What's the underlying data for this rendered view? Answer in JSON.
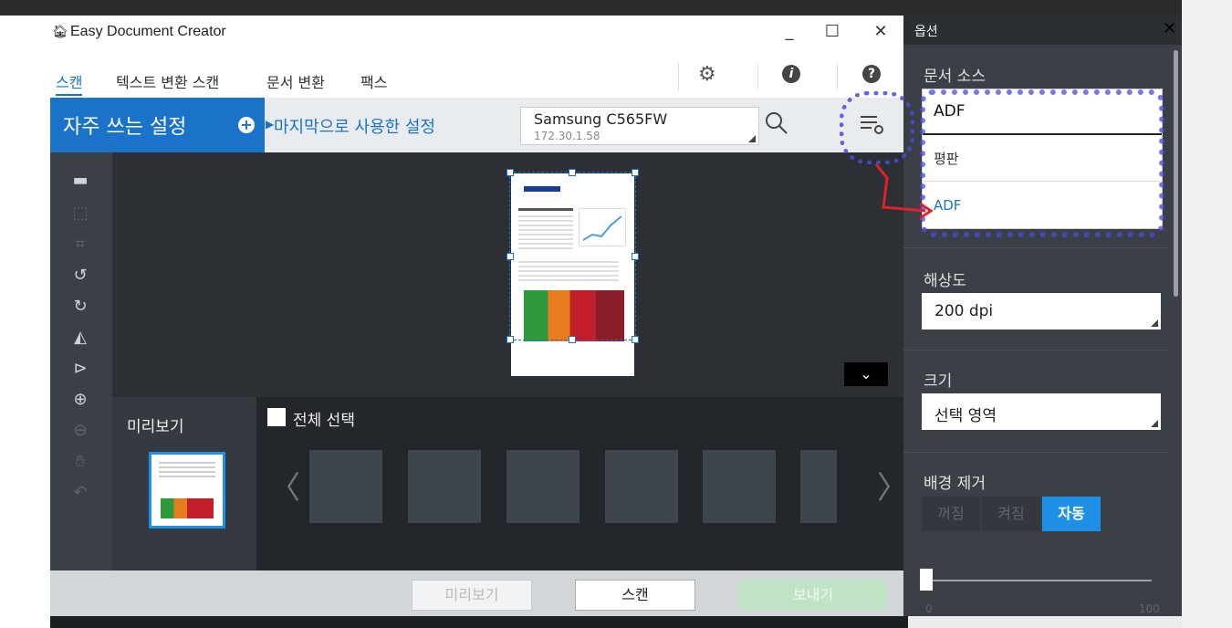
{
  "app": {
    "title": "Easy Document Creator",
    "window_buttons": {
      "minimize": "_",
      "maximize": "☐",
      "close": "✕"
    }
  },
  "menu": {
    "items": [
      "스캔",
      "텍스트 변환 스캔",
      "문서 변환",
      "팩스"
    ]
  },
  "presets": {
    "title": "자주 쓰는 설정",
    "plus": "+",
    "last_used": "마지막으로 사용한 설정"
  },
  "device": {
    "name": "Samsung C565FW",
    "ip": "172.30.1.58"
  },
  "preview": {
    "label": "미리보기",
    "select_all": "전체 선택",
    "nav_prev": "〈",
    "nav_next": "〉",
    "collapse": "⌄"
  },
  "bottom": {
    "preview": "미리보기",
    "scan": "스캔",
    "send": "보내기"
  },
  "options": {
    "title": "옵션",
    "close": "✕",
    "source": {
      "label": "문서 소스",
      "value": "ADF",
      "dropdown": [
        "평판",
        "ADF"
      ]
    },
    "resolution": {
      "label": "해상도",
      "value": "200 dpi"
    },
    "size": {
      "label": "크기",
      "value": "선택 영역"
    },
    "background_removal": {
      "label": "배경 제거",
      "options": [
        "꺼짐",
        "켜짐",
        "자동"
      ],
      "selected": "자동"
    },
    "slider": {
      "min": "0",
      "max": "100",
      "value": 0
    }
  },
  "colors": {
    "accent": "#1a73c8",
    "panel": "#3b4046",
    "active_seg": "#1e90e6"
  }
}
